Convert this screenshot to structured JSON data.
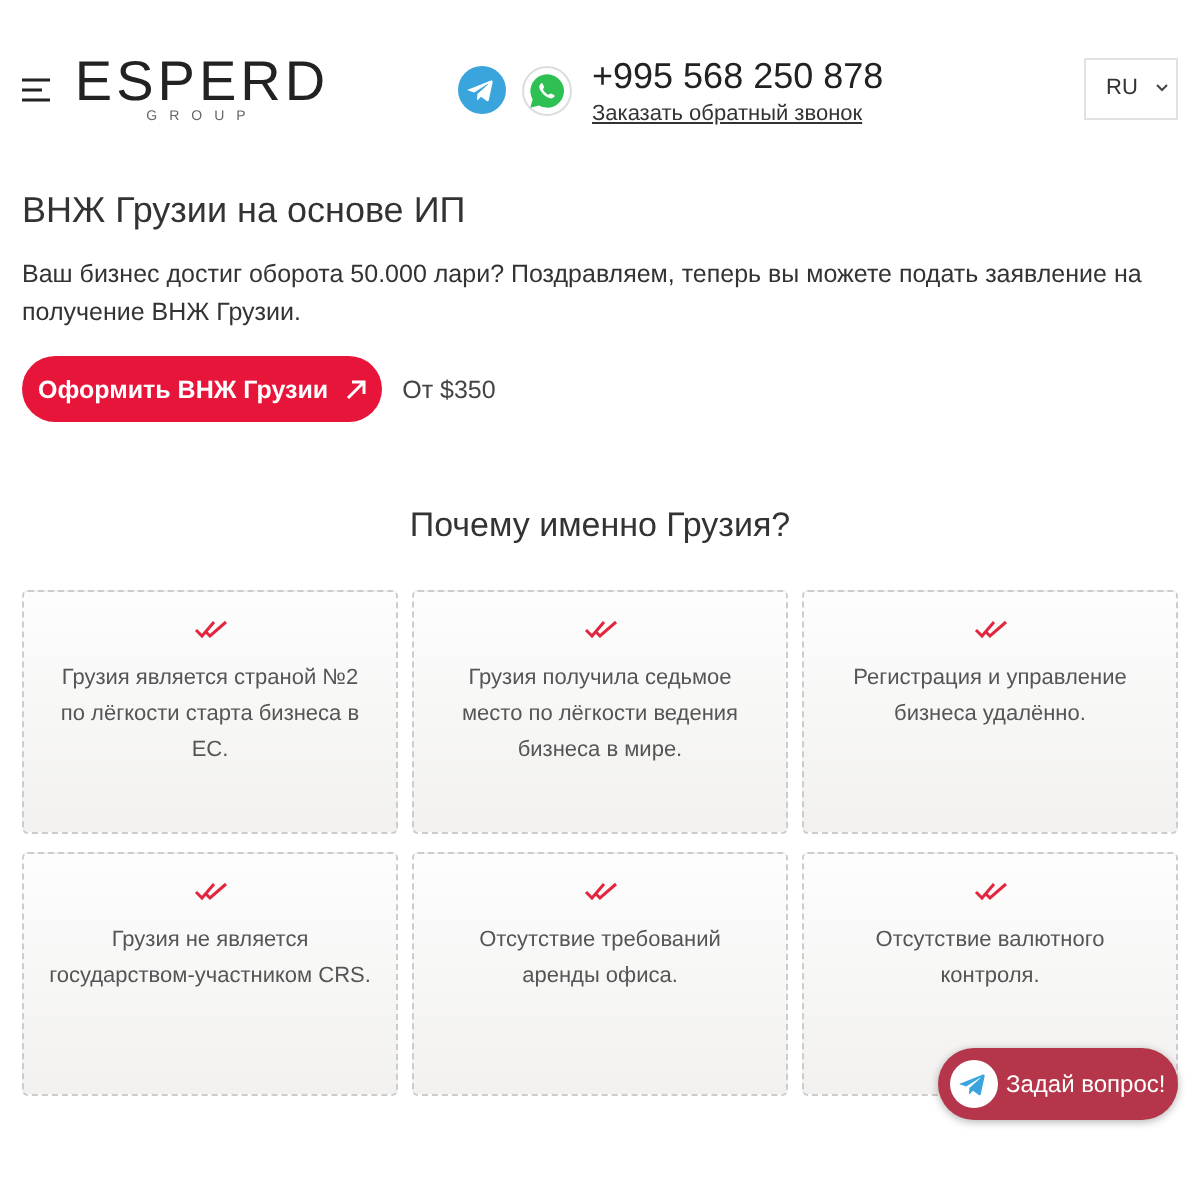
{
  "header": {
    "logo": {
      "name": "ESPERD",
      "subtitle": "GROUP"
    },
    "phone": "+995 568 250 878",
    "callback_link": "Заказать обратный звонок",
    "language": "RU"
  },
  "hero": {
    "title": "ВНЖ Грузии на основе ИП",
    "text": "Ваш бизнес достиг оборота 50.000 лари? Поздравляем, теперь вы можете подать заявление на получение ВНЖ Грузии.",
    "button": "Оформить ВНЖ Грузии",
    "price": "От $350"
  },
  "section": {
    "title": "Почему именно Грузия?",
    "cards": [
      {
        "text": "Грузия является страной №2 по лёгкости старта бизнеса в ЕС."
      },
      {
        "text": "Грузия получила седьмое место по лёгкости ведения бизнеса в мире."
      },
      {
        "text": "Регистрация и управление бизнеса удалённо."
      },
      {
        "text": "Грузия не является государством-участником CRS."
      },
      {
        "text": "Отсутствие требований аренды офиса."
      },
      {
        "text": "Отсутствие валютного контроля."
      }
    ]
  },
  "chat_button": "Задай вопрос!"
}
